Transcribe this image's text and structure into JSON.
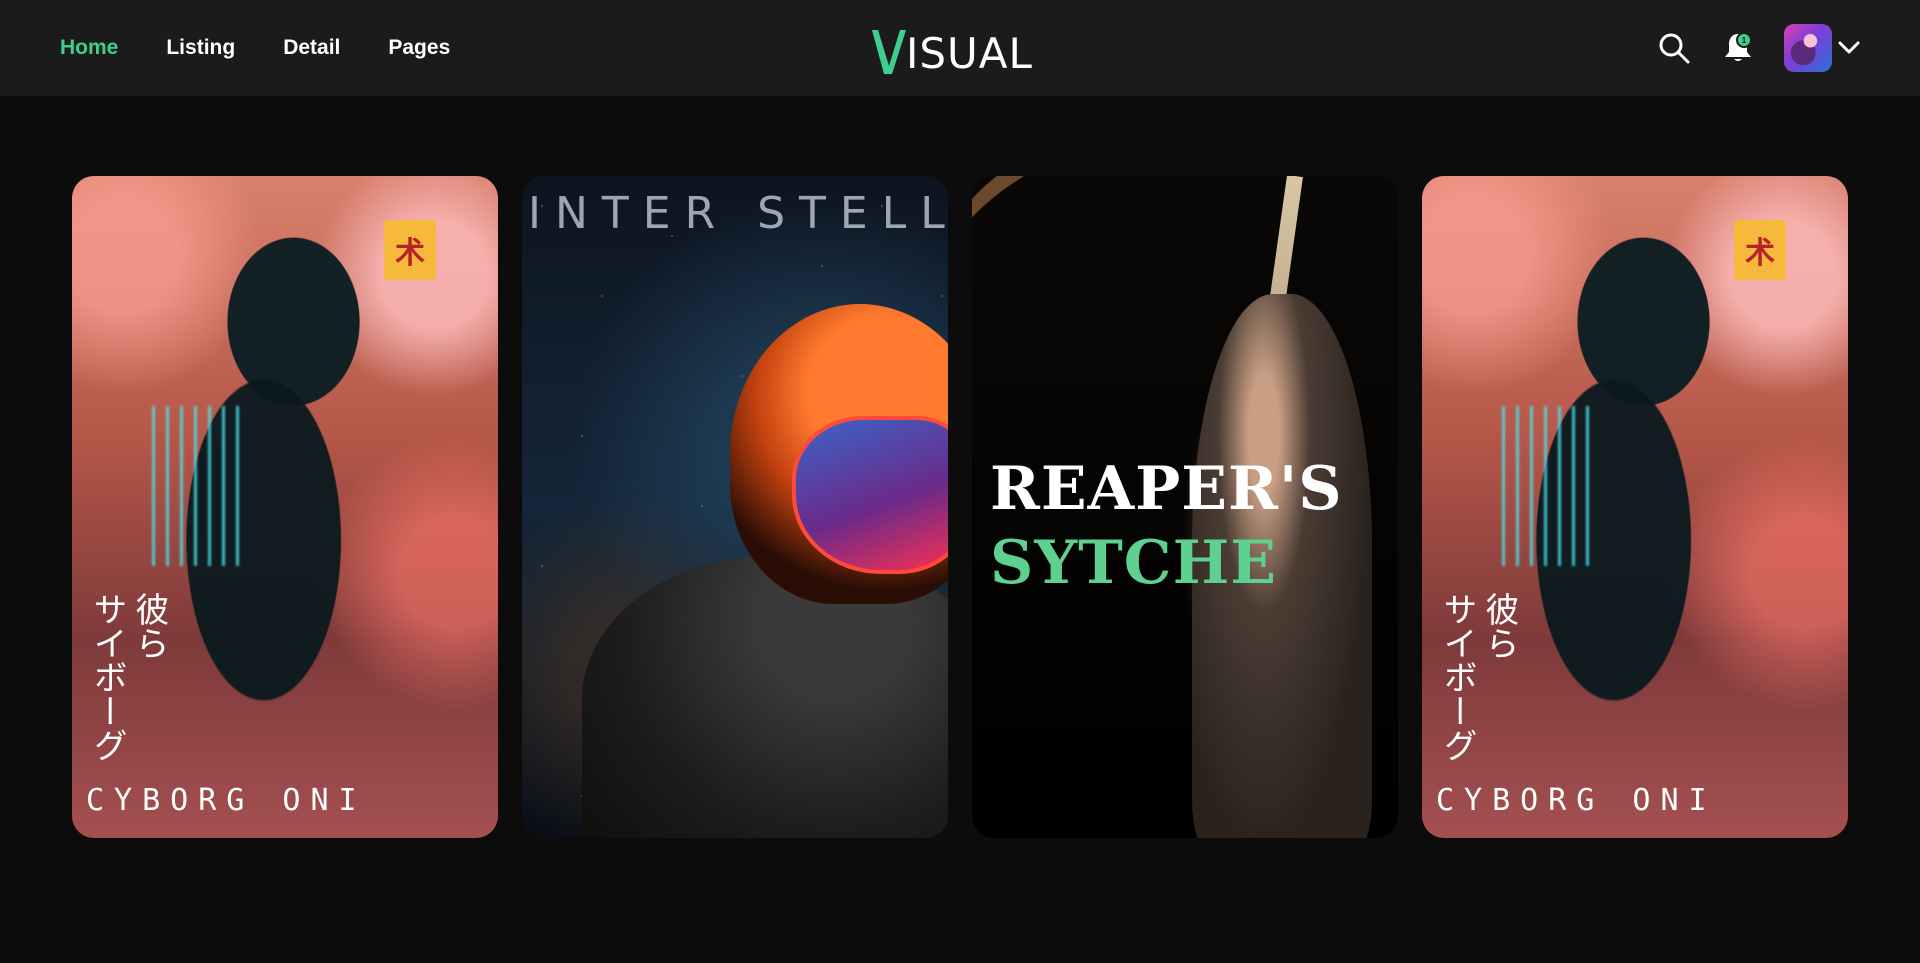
{
  "nav": {
    "items": [
      {
        "label": "Home",
        "active": true
      },
      {
        "label": "Listing",
        "active": false
      },
      {
        "label": "Detail",
        "active": false
      },
      {
        "label": "Pages",
        "active": false
      }
    ]
  },
  "logo": {
    "text": "ISUAL",
    "mark": "V",
    "mark_color": "#3ecf8e"
  },
  "header_actions": {
    "search_icon": "search-icon",
    "notification_icon": "bell-icon",
    "notification_badge": "1",
    "avatar": "user-avatar",
    "dropdown_icon": "chevron-down-icon"
  },
  "cards": [
    {
      "type": "poster",
      "title": "CYBORG ONI",
      "jp_col1": "彼ら",
      "jp_col2": "サイボーグ",
      "sign": "术"
    },
    {
      "type": "poster",
      "title": "INTER STELLAR"
    },
    {
      "type": "poster",
      "title_line1": "REAPER'S",
      "title_line2": "SYTCHE"
    },
    {
      "type": "poster",
      "title": "CYBORG ONI",
      "jp_col1": "彼ら",
      "jp_col2": "サイボーグ",
      "sign": "术"
    }
  ],
  "colors": {
    "background": "#0c0c0c",
    "header": "#1b1b1b",
    "accent": "#3ecf8e"
  }
}
